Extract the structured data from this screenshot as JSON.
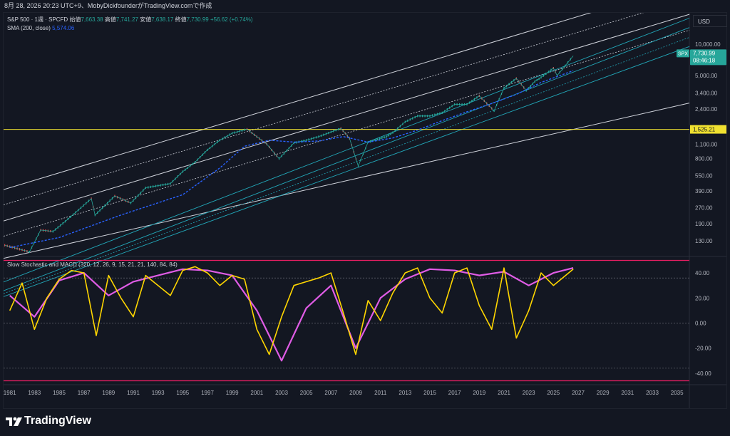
{
  "header": {
    "published_by": "8月 28, 2026 20:23 UTC+9、MobyDickfounderがTradingView.comで作成"
  },
  "main_legend": {
    "symbol": "S&P 500 · 1週 · SPCFD",
    "open_label": "始値",
    "open": "7,663.38",
    "high_label": "高値",
    "high": "7,741.27",
    "low_label": "安値",
    "low": "7,638.17",
    "close_label": "終値",
    "close": "7,730.99",
    "change": "+56.62 (+0.74%)",
    "sma_label": "SMA (200, close)",
    "sma_value": "5,574.06"
  },
  "indicator_legend": "Slow Stochastic and MACD (320, 12, 26, 9, 15, 21, 21, 140, 84, 84)",
  "currency": "USD",
  "price_badge": {
    "symbol": "SPX",
    "price": "7,730.99",
    "countdown": "08:46:18"
  },
  "level_badge": "1,525.21",
  "brand": "TradingView",
  "colors": {
    "background": "#131722",
    "price_up": "#26a69a",
    "price_down": "#ef5350",
    "sma": "#2962ff",
    "horizontal_level": "#f0e130",
    "channel_outer": "#d1d4dc",
    "channel_teal": "#22a7b8",
    "stoch_k": "#ffd600",
    "slow_line": "#e05ce6",
    "osc_bounds": "#e91e63"
  },
  "chart_data": [
    {
      "type": "line",
      "title": "S&P 500 · 1週 · SPCFD",
      "x_axis_ticks": [
        "1981",
        "1983",
        "1985",
        "1987",
        "1989",
        "1991",
        "1993",
        "1995",
        "1997",
        "1999",
        "2001",
        "2003",
        "2005",
        "2007",
        "2009",
        "2011",
        "2013",
        "2015",
        "2017",
        "2019",
        "2021",
        "2023",
        "2025",
        "2027",
        "2029",
        "2031",
        "2033",
        "2035"
      ],
      "y_scale": "log",
      "y_axis_ticks": [
        "10,000.00",
        "5,000.00",
        "3,400.00",
        "2,400.00",
        "1,600.00",
        "1,100.00",
        "800.00",
        "550.00",
        "390.00",
        "270.00",
        "190.00",
        "130.00"
      ],
      "xlim": [
        1980.5,
        2036
      ],
      "ylim": [
        95,
        20000
      ],
      "series": [
        {
          "name": "S&P 500",
          "x": [
            1980.6,
            1982.6,
            1983.5,
            1984.5,
            1985.5,
            1987.6,
            1987.9,
            1989.5,
            1990.8,
            1992,
            1994,
            1995,
            1996,
            1997,
            1998,
            1999,
            2000.2,
            2001.8,
            2002.8,
            2004,
            2005,
            2006,
            2007.8,
            2008.5,
            2009.2,
            2010,
            2011.5,
            2012,
            2013,
            2014,
            2015,
            2016,
            2017,
            2018,
            2019,
            2020.2,
            2021,
            2022,
            2022.8,
            2023.5,
            2024,
            2025,
            2025.3,
            2026.6
          ],
          "values": [
            118,
            102,
            165,
            160,
            200,
            330,
            230,
            350,
            300,
            420,
            460,
            600,
            740,
            970,
            1200,
            1400,
            1530,
            1100,
            800,
            1130,
            1200,
            1300,
            1560,
            1250,
            680,
            1150,
            1300,
            1420,
            1800,
            2050,
            2050,
            2200,
            2650,
            2650,
            3200,
            2300,
            3800,
            4700,
            3600,
            4400,
            4800,
            5900,
            5000,
            7731
          ]
        },
        {
          "name": "SMA (200, close)",
          "x": [
            1981,
            1985,
            1990,
            1995,
            1998,
            2000,
            2002,
            2004,
            2006,
            2008,
            2010,
            2012,
            2014,
            2016,
            2018,
            2020,
            2022,
            2024,
            2026.6
          ],
          "values": [
            112,
            140,
            230,
            360,
            650,
            1050,
            1200,
            1150,
            1180,
            1300,
            1150,
            1260,
            1500,
            1850,
            2250,
            2700,
            3300,
            4300,
            5574
          ]
        }
      ],
      "levels": [
        {
          "label": "1,525.21",
          "value": 1525.21
        }
      ]
    },
    {
      "type": "line",
      "title": "Slow Stochastic and MACD (320, 12, 26, 9, 15, 21, 21, 140, 84, 84)",
      "y_axis_ticks": [
        "40.00",
        "20.00",
        "0.00",
        "-20.00",
        "-40.00"
      ],
      "ylim": [
        -48,
        52
      ],
      "series": [
        {
          "x": [
            1981,
            1982,
            1983,
            1984,
            1985,
            1986,
            1987,
            1988,
            1989,
            1990,
            1991,
            1992,
            1993,
            1994,
            1995,
            1996,
            1997,
            1998,
            1999,
            2000,
            2001,
            2002,
            2003,
            2004,
            2005,
            2006,
            2007,
            2008,
            2009,
            2010,
            2011,
            2012,
            2013,
            2014,
            2015,
            2016,
            2017,
            2018,
            2019,
            2020,
            2021,
            2022,
            2023,
            2024,
            2025,
            2026.6
          ],
          "values": [
            10,
            32,
            -5,
            20,
            35,
            42,
            40,
            -10,
            38,
            20,
            5,
            38,
            30,
            22,
            42,
            45,
            40,
            30,
            38,
            35,
            -5,
            -25,
            5,
            30,
            33,
            36,
            40,
            8,
            -25,
            18,
            2,
            24,
            40,
            44,
            20,
            8,
            40,
            44,
            14,
            -5,
            44,
            -12,
            10,
            40,
            30,
            43
          ]
        },
        {
          "x": [
            1981,
            1983,
            1985,
            1987,
            1989,
            1991,
            1993,
            1995,
            1997,
            1999,
            2001,
            2003,
            2005,
            2007,
            2009,
            2011,
            2013,
            2015,
            2017,
            2019,
            2021,
            2023,
            2025,
            2026.6
          ],
          "values": [
            22,
            5,
            34,
            40,
            22,
            33,
            38,
            43,
            42,
            38,
            10,
            -30,
            12,
            30,
            -20,
            20,
            35,
            43,
            42,
            38,
            41,
            30,
            40,
            44
          ]
        }
      ]
    }
  ]
}
